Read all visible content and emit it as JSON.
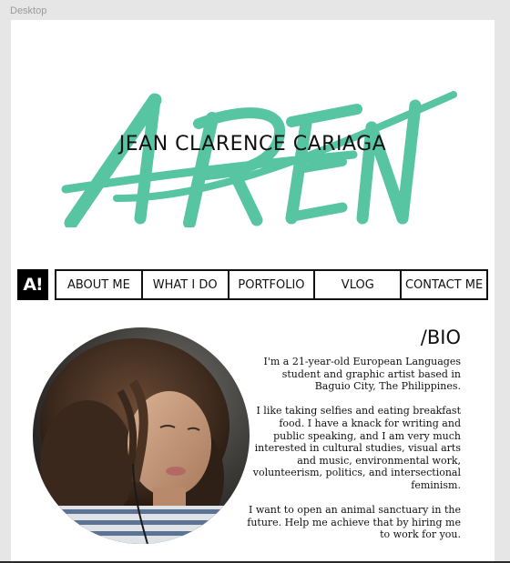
{
  "canvas": {
    "frame_label": "Desktop"
  },
  "hero": {
    "brush_word": "AREN",
    "name": "JEAN CLARENCE CARIAGA"
  },
  "logo": {
    "text": "A!"
  },
  "nav": {
    "items": [
      {
        "label": "ABOUT ME"
      },
      {
        "label": "WHAT I DO"
      },
      {
        "label": "PORTFOLIO"
      },
      {
        "label": "VLOG"
      },
      {
        "label": "CONTACT ME"
      }
    ]
  },
  "bio": {
    "heading": "/BIO",
    "paragraphs": [
      "I'm a 21-year-old European Languages student and graphic artist based in Baguio City, The Philippines.",
      "I like taking selfies and eating breakfast food. I have a knack for writing and public speaking, and I am very much interested in cultural studies, visual arts and music, environmental work, volunteerism, politics, and intersectional feminism.",
      "I want to open an animal sanctuary in the future. Help me achieve that by hiring me to work for you."
    ]
  },
  "colors": {
    "brand_mint": "#57c4a2",
    "text": "#111111",
    "canvas_bg": "#e6e6e6"
  }
}
